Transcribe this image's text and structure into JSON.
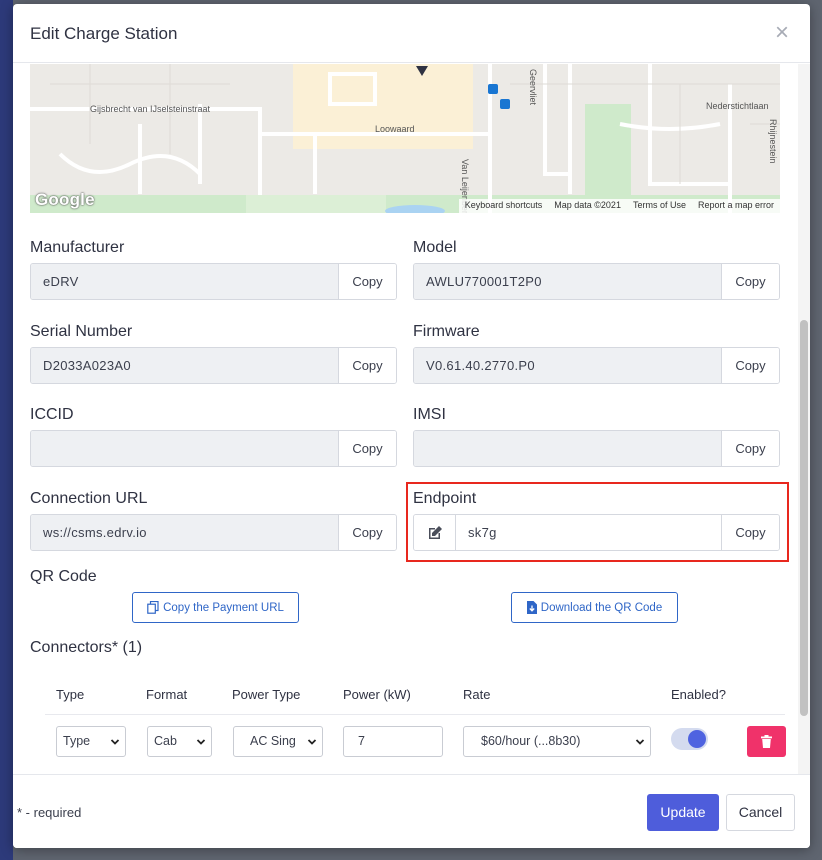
{
  "dialog": {
    "title": "Edit Charge Station",
    "close_symbol": "×"
  },
  "map": {
    "streets": [
      "Gijsbrecht van IJselsteinstraat",
      "Loowaard",
      "Van Leijenberghlaan",
      "Geervliet",
      "Nederstichtlaan",
      "Rhijnestein"
    ],
    "logo_text": "Google",
    "attribution": [
      "Keyboard shortcuts",
      "Map data ©2021",
      "Terms of Use",
      "Report a map error"
    ]
  },
  "fields": {
    "copy_label": "Copy",
    "manufacturer": {
      "label": "Manufacturer",
      "value": "eDRV"
    },
    "model": {
      "label": "Model",
      "value": "AWLU770001T2P0"
    },
    "serial_number": {
      "label": "Serial Number",
      "value": "D2033A023A0"
    },
    "firmware": {
      "label": "Firmware",
      "value": "V0.61.40.2770.P0"
    },
    "iccid": {
      "label": "ICCID",
      "value": ""
    },
    "imsi": {
      "label": "IMSI",
      "value": ""
    },
    "connection_url": {
      "label": "Connection URL",
      "value": "ws://csms.edrv.io"
    },
    "endpoint": {
      "label": "Endpoint",
      "value": "sk7g"
    }
  },
  "qr": {
    "title": "QR Code",
    "copy_payment_url": "Copy the Payment URL",
    "download_qr": "Download the QR Code"
  },
  "connectors": {
    "title": "Connectors* (1)",
    "headers": [
      "Type",
      "Format",
      "Power Type",
      "Power (kW)",
      "Rate",
      "Enabled?"
    ],
    "row": {
      "type": "Type",
      "format": "Cab",
      "power_type": "AC Sing",
      "power_kw": "7",
      "rate": "$60/hour (...8b30)",
      "enabled": true
    }
  },
  "footer": {
    "required_note": "* - required",
    "update_label": "Update",
    "cancel_label": "Cancel"
  },
  "colors": {
    "primary": "#4e5ddb",
    "link_blue": "#2f66c7",
    "danger": "#f0326a",
    "highlight": "#e8281e"
  }
}
